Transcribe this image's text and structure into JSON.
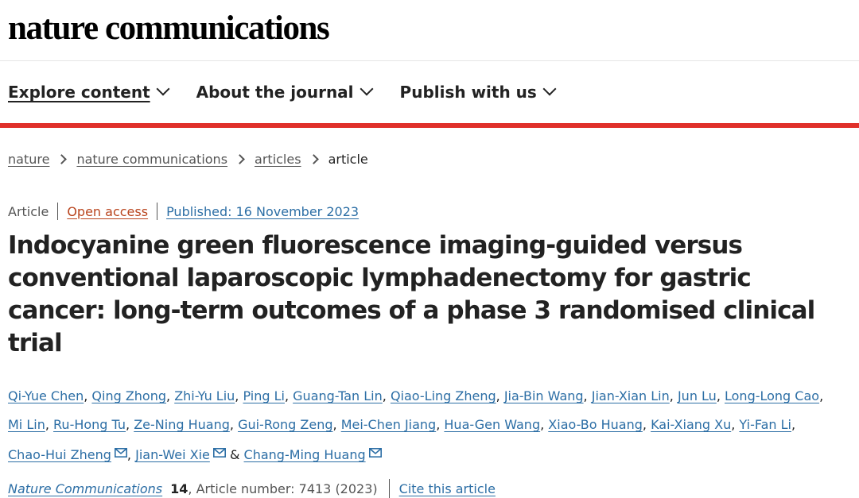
{
  "header": {
    "logo": "nature communications"
  },
  "nav": {
    "items": [
      {
        "label": "Explore content",
        "icon": "chevron-down-icon",
        "active": true
      },
      {
        "label": "About the journal",
        "icon": "chevron-down-icon"
      },
      {
        "label": "Publish with us",
        "icon": "chevron-down-icon"
      }
    ]
  },
  "breadcrumb": {
    "items": [
      "nature",
      "nature communications",
      "articles"
    ],
    "current": "article"
  },
  "article": {
    "type": "Article",
    "access": "Open access",
    "published": "Published: 16 November 2023",
    "title": "Indocyanine green fluorescence imaging-guided versus conventional laparoscopic lymphadenectomy for gastric cancer: long-term outcomes of a phase 3 randomised clinical trial"
  },
  "authors": {
    "list": [
      "Qi-Yue Chen",
      "Qing Zhong",
      "Zhi-Yu Liu",
      "Ping Li",
      "Guang-Tan Lin",
      "Qiao-Ling Zheng",
      "Jia-Bin Wang",
      "Jian-Xian Lin",
      "Jun Lu",
      "Long-Long Cao",
      "Mi Lin",
      "Ru-Hong Tu",
      "Ze-Ning Huang",
      "Gui-Rong Zeng",
      "Mei-Chen Jiang",
      "Hua-Gen Wang",
      "Xiao-Bo Huang",
      "Kai-Xiang Xu",
      "Yi-Fan Li"
    ],
    "corresponding": [
      "Chao-Hui Zheng",
      "Jian-Wei Xie",
      "Chang-Ming Huang"
    ],
    "separator": ",",
    "conjunction": "&",
    "mail_icon": "envelope-icon"
  },
  "citation": {
    "journal": "Nature Communications",
    "volume": "14",
    "article_number": ", Article number: 7413 (2023)",
    "cite_label": "Cite this article"
  },
  "colors": {
    "accent_red": "#e0302a",
    "link_blue": "#2c6ea5",
    "open_access": "#b9441d"
  }
}
